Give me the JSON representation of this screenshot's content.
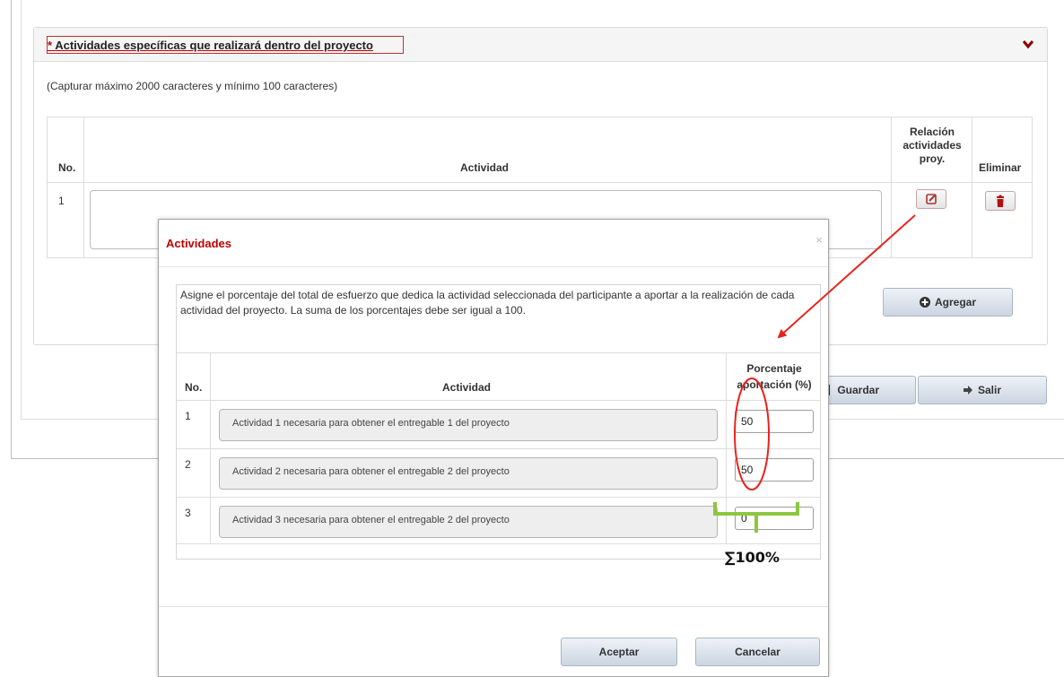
{
  "panel": {
    "required_mark": "*",
    "title": "Actividades específicas que realizará dentro del proyecto",
    "capture_note": "(Capturar máximo 2000 caracteres y mínimo 100 caracteres)"
  },
  "bg_table": {
    "headers": {
      "no": "No.",
      "actividad": "Actividad",
      "relacion": [
        "Relación",
        "actividades",
        "proy."
      ],
      "eliminar": "Eliminar"
    },
    "rows": [
      {
        "no": "1",
        "actividad": ""
      }
    ]
  },
  "buttons": {
    "agregar": "Agregar",
    "guardar": "Guardar",
    "salir": "Salir"
  },
  "modal": {
    "title": "Actividades",
    "close": "×",
    "instructions": "Asigne el porcentaje del total de esfuerzo que dedica la actividad seleccionada del participante a aportar a la realización de cada actividad del proyecto. La suma de los porcentajes debe ser igual a 100.",
    "table_headers": {
      "no": "No.",
      "actividad": "Actividad",
      "porcentaje": [
        "Porcentaje",
        "aportación (%)"
      ]
    },
    "rows": [
      {
        "no": "1",
        "actividad": "Actividad 1 necesaria para obtener el entregable 1 del proyecto",
        "porcentaje": "50"
      },
      {
        "no": "2",
        "actividad": "Actividad 2 necesaria para obtener el entregable 2 del proyecto",
        "porcentaje": "50"
      },
      {
        "no": "3",
        "actividad": "Actividad 3 necesaria para obtener el entregable 2 del proyecto",
        "porcentaje": "0"
      }
    ],
    "aceptar": "Aceptar",
    "cancelar": "Cancelar"
  },
  "annotation": {
    "sum_label": "∑100%"
  },
  "colors": {
    "title_red": "#c00000",
    "arrow_red": "#e8231d",
    "bracket_green": "#8dc63f",
    "button_blue_top": "#eef2f7",
    "button_blue_bottom": "#cbd5e1"
  },
  "icons": [
    "chevron-down-icon",
    "edit-icon",
    "trash-icon",
    "plus-circle-icon",
    "save-icon",
    "exit-icon",
    "close-icon"
  ]
}
